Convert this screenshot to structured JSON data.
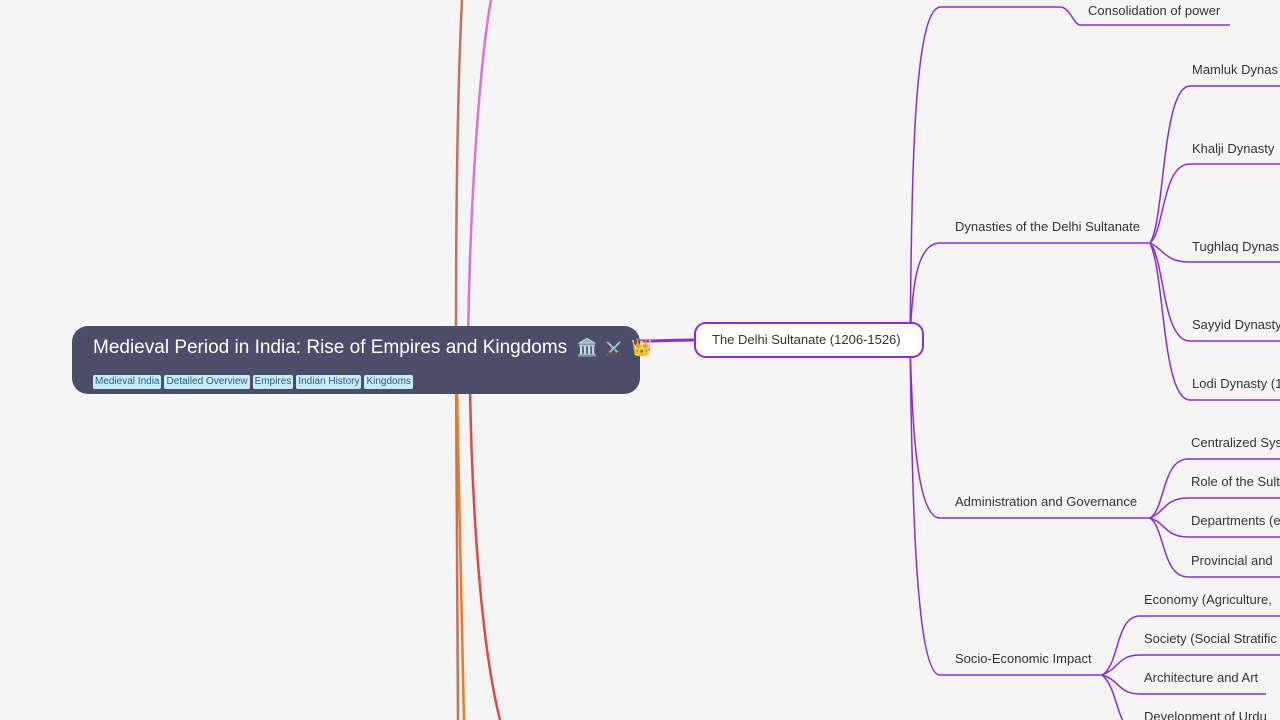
{
  "root": {
    "title": "Medieval Period in India: Rise of Empires and Kingdoms",
    "emojis": [
      "🏛️",
      "⚔️",
      "👑"
    ],
    "tags": [
      "Medieval India",
      "Detailed Overview",
      "Empires",
      "Indian History",
      "Kingdoms"
    ]
  },
  "branch": {
    "title": "The Delhi Sultanate (1206-1526)",
    "prev_child": "Consolidation of power",
    "children": [
      {
        "label": "Dynasties of the Delhi Sultanate",
        "items": [
          "Mamluk Dynas",
          "Khalji Dynasty",
          "Tughlaq Dynas",
          "Sayyid Dynasty",
          "Lodi Dynasty (1"
        ]
      },
      {
        "label": "Administration and Governance",
        "items": [
          "Centralized Sys",
          "Role of the Sult",
          "Departments (e",
          "Provincial and"
        ]
      },
      {
        "label": "Socio-Economic Impact",
        "items": [
          "Economy (Agriculture,",
          "Society (Social Stratific",
          "Architecture and Art",
          "Development of Urdu"
        ]
      }
    ]
  },
  "colors": {
    "background": "#f5f5f5",
    "root_fill": "#4a4e69",
    "branch_purple": "#8a2be2",
    "link_pink": "#e070d8",
    "link_brown": "#c8705a",
    "link_orange": "#f07a20",
    "link_red": "#e04848"
  }
}
